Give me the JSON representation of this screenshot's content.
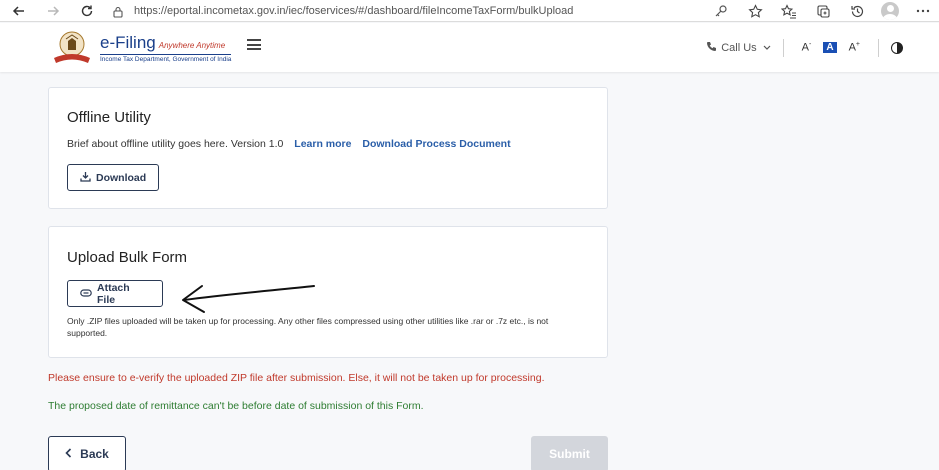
{
  "browser": {
    "url": "https://eportal.incometax.gov.in/iec/foservices/#/dashboard/fileIncomeTaxForm/bulkUpload",
    "nav_icons": [
      "back-icon",
      "forward-icon",
      "refresh-icon",
      "lock-icon"
    ],
    "toolbar_icons": [
      "key-icon",
      "favorite-star-icon",
      "favorites-list-icon",
      "collections-icon",
      "history-icon",
      "profile-avatar",
      "more-icon"
    ]
  },
  "header": {
    "brand_title": "e-Filing",
    "brand_tagline": "Anywhere Anytime",
    "brand_sub": "Income Tax Department, Government of India",
    "call_us": "Call Us",
    "font_decrease": "A",
    "font_normal": "A",
    "font_increase": "A",
    "font_decrease_sign": "-",
    "font_increase_sign": "+"
  },
  "offline": {
    "title": "Offline Utility",
    "description": "Brief about offline utility goes here. Version 1.0",
    "learn_more": "Learn more",
    "download_doc": "Download Process Document",
    "download_button": "Download"
  },
  "upload": {
    "title": "Upload Bulk Form",
    "attach_button": "Attach File",
    "note": "Only .ZIP files uploaded will be taken up for processing. Any other files compressed using other utilities like .rar or .7z etc., is not supported."
  },
  "messages": {
    "everify_warning": "Please ensure to e-verify the uploaded ZIP file after submission. Else, it will not be taken up for processing.",
    "remittance_note": "The proposed date of remittance can't be before date of submission of this Form."
  },
  "actions": {
    "back": "Back",
    "submit": "Submit"
  },
  "colors": {
    "brand_blue": "#1a3f8a",
    "link_blue": "#2a5ea8",
    "warning_red": "#c0392b",
    "info_green": "#2e7d32",
    "button_outline": "#2b3a55",
    "submit_disabled": "#d3d6dc"
  }
}
